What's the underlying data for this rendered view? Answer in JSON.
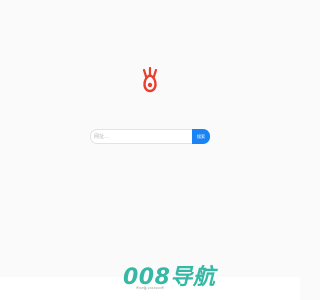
{
  "logo": {
    "icon": "flame-q-logo-icon",
    "color": "#e8402f"
  },
  "search": {
    "placeholder": "网址...",
    "button_label": "搜索",
    "button_color": "#1a84f5"
  },
  "footer": {
    "text": "粤ICP备 2023000号"
  },
  "watermark": {
    "text": "008导航",
    "color": "#24b39e"
  }
}
